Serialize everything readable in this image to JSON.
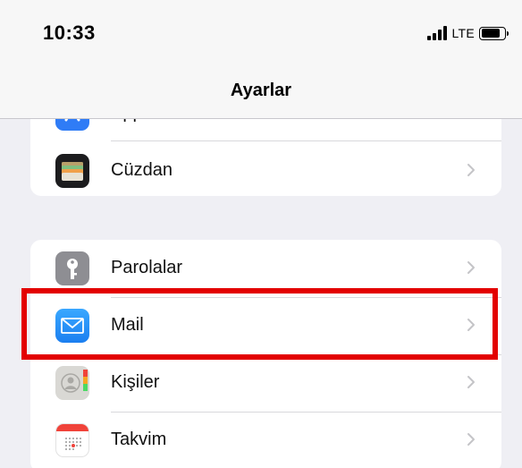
{
  "status_bar": {
    "time": "10:33",
    "network": "LTE",
    "signal_icon": "cellular-signal-icon",
    "battery_icon": "battery-icon",
    "battery_level": 0.85
  },
  "nav": {
    "title": "Ayarlar"
  },
  "group_one": {
    "items": [
      {
        "label": "App Store",
        "icon": "app-store-icon"
      },
      {
        "label": "Cüzdan",
        "icon": "wallet-icon"
      }
    ]
  },
  "group_two": {
    "items": [
      {
        "label": "Parolalar",
        "icon": "key-icon"
      },
      {
        "label": "Mail",
        "icon": "mail-icon"
      },
      {
        "label": "Kişiler",
        "icon": "contacts-icon"
      },
      {
        "label": "Takvim",
        "icon": "calendar-icon"
      }
    ]
  },
  "colors": {
    "highlight": "#e30000",
    "mail_blue": "#1b8ff5",
    "app_store_blue": "#2f7cf6",
    "calendar_red": "#f0433a"
  }
}
